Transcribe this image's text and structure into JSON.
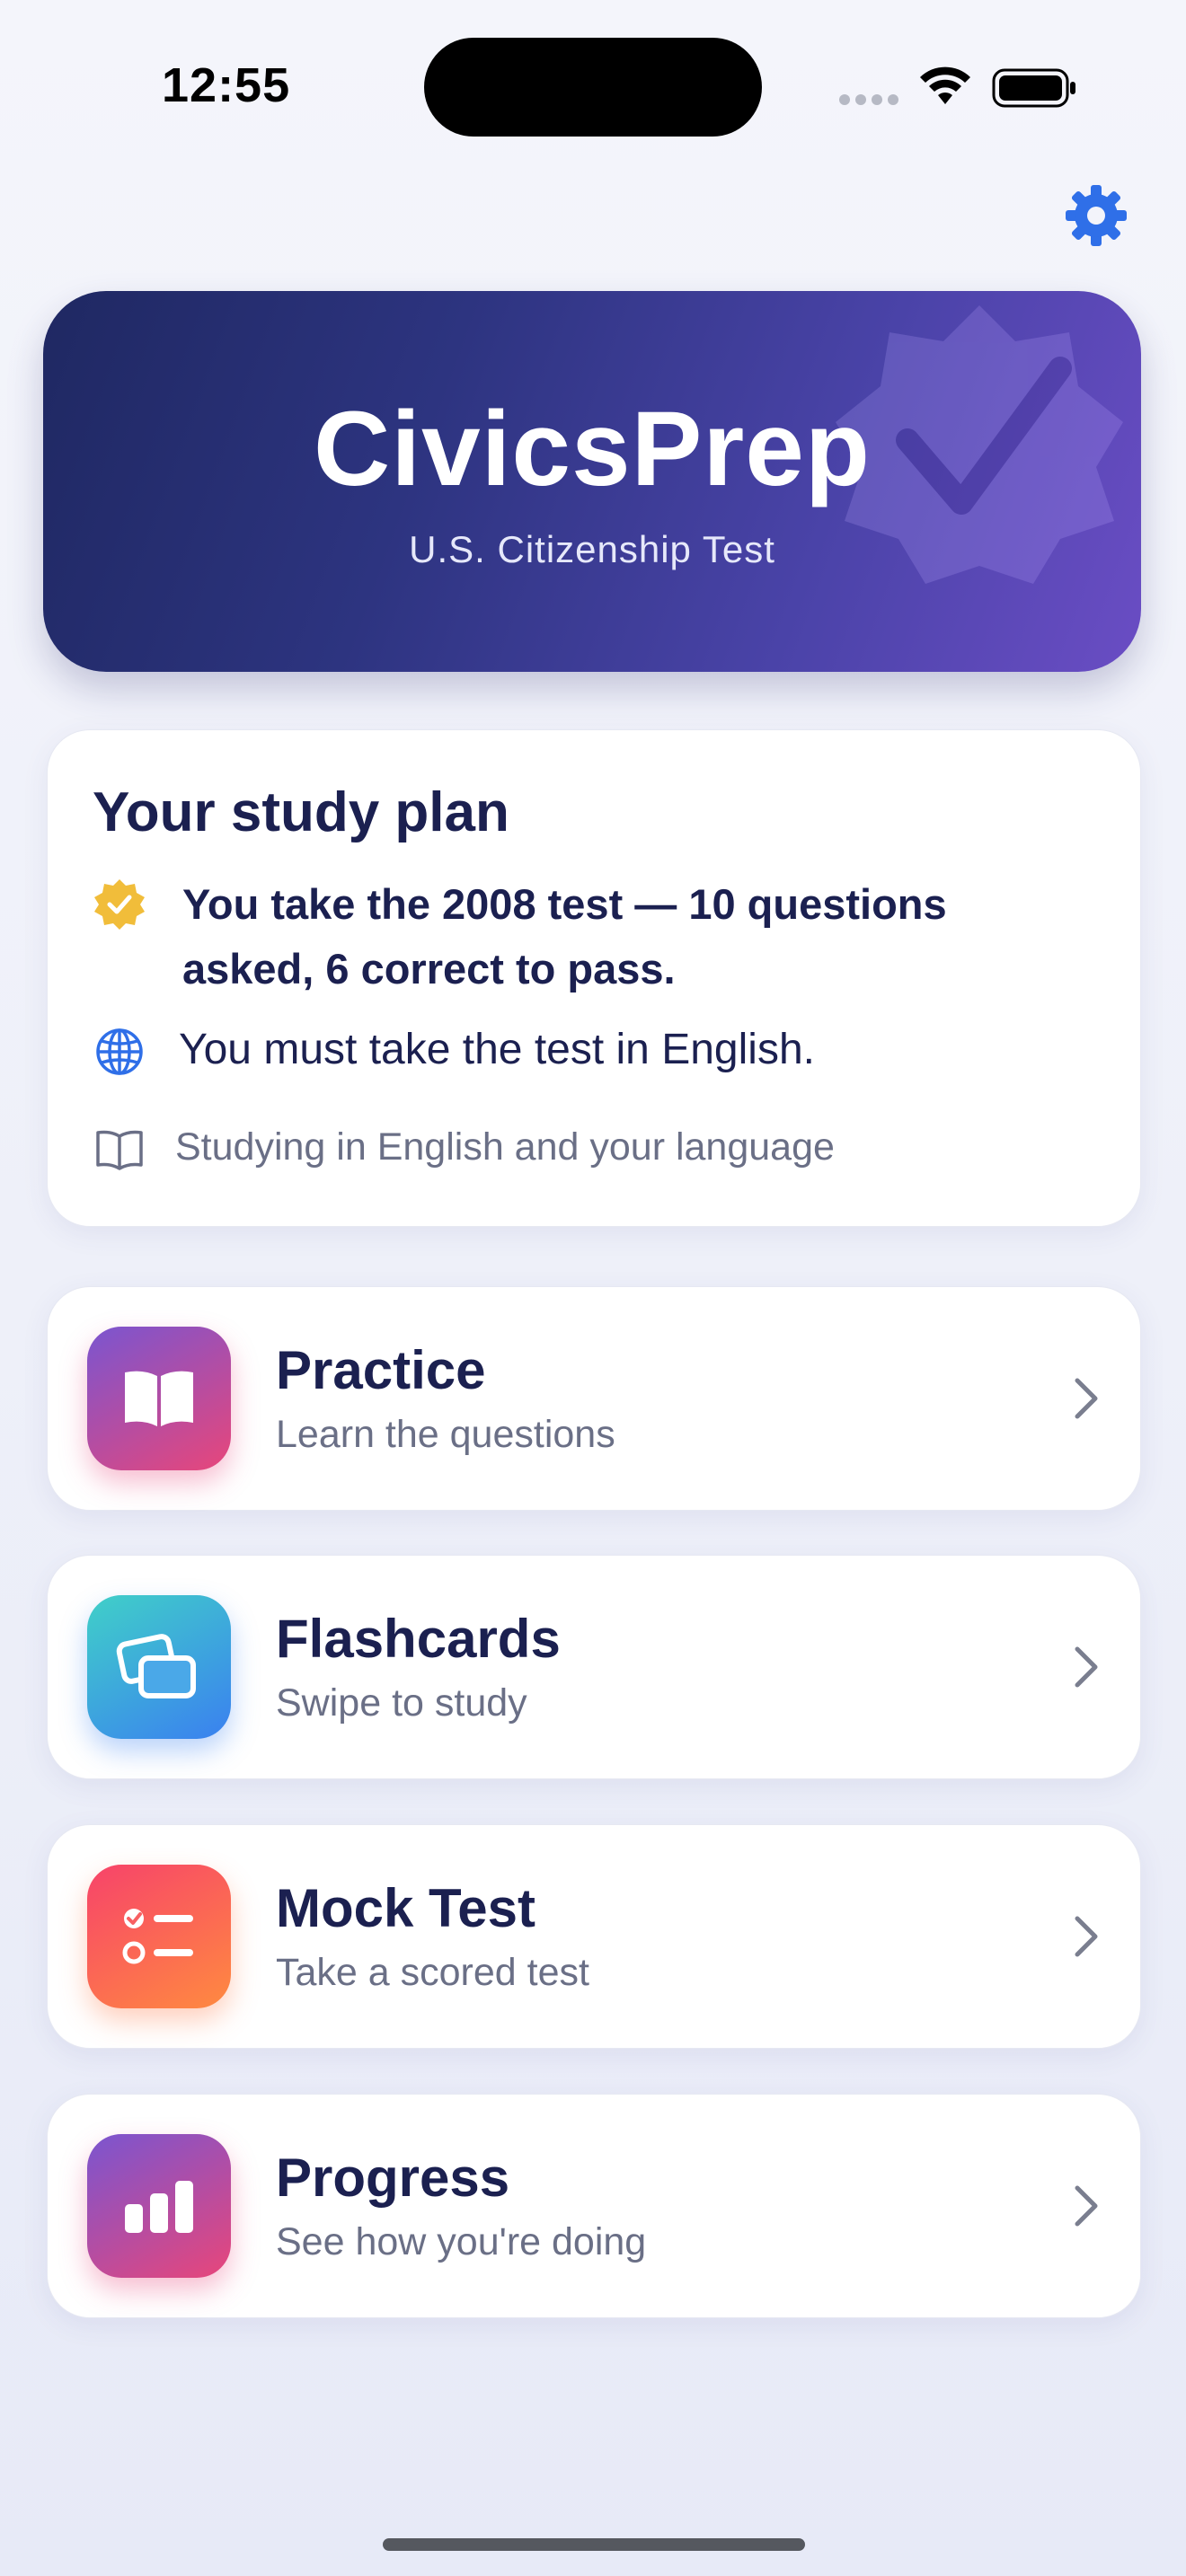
{
  "status_bar": {
    "time": "12:55"
  },
  "header": {
    "settings_icon": "gear-icon",
    "accent_color": "#2f6fe8"
  },
  "hero": {
    "title": "CivicsPrep",
    "subtitle": "U.S. Citizenship Test",
    "badge_icon": "checkmark-badge-icon",
    "gradient": [
      "#1f2862",
      "#6a4dc4"
    ]
  },
  "study_plan": {
    "title": "Your study plan",
    "items": [
      {
        "icon": "checkmark-seal-icon",
        "text": "You take the 2008 test — 10 questions asked, 6 correct to pass."
      },
      {
        "icon": "globe-icon",
        "text": "You must take the test in English."
      },
      {
        "icon": "book-icon",
        "text": "Studying in English and your language"
      }
    ]
  },
  "menu": [
    {
      "title": "Practice",
      "subtitle": "Learn the questions",
      "icon": "open-book-icon",
      "colors": [
        "#7a55d0",
        "#e8467a"
      ]
    },
    {
      "title": "Flashcards",
      "subtitle": "Swipe to study",
      "icon": "cards-icon",
      "colors": [
        "#40d0c8",
        "#3a80f0"
      ]
    },
    {
      "title": "Mock Test",
      "subtitle": "Take a scored test",
      "icon": "checklist-icon",
      "colors": [
        "#f7436a",
        "#ff8a40"
      ]
    },
    {
      "title": "Progress",
      "subtitle": "See how you're doing",
      "icon": "bar-chart-icon",
      "colors": [
        "#7a55d0",
        "#e8467a"
      ]
    }
  ]
}
